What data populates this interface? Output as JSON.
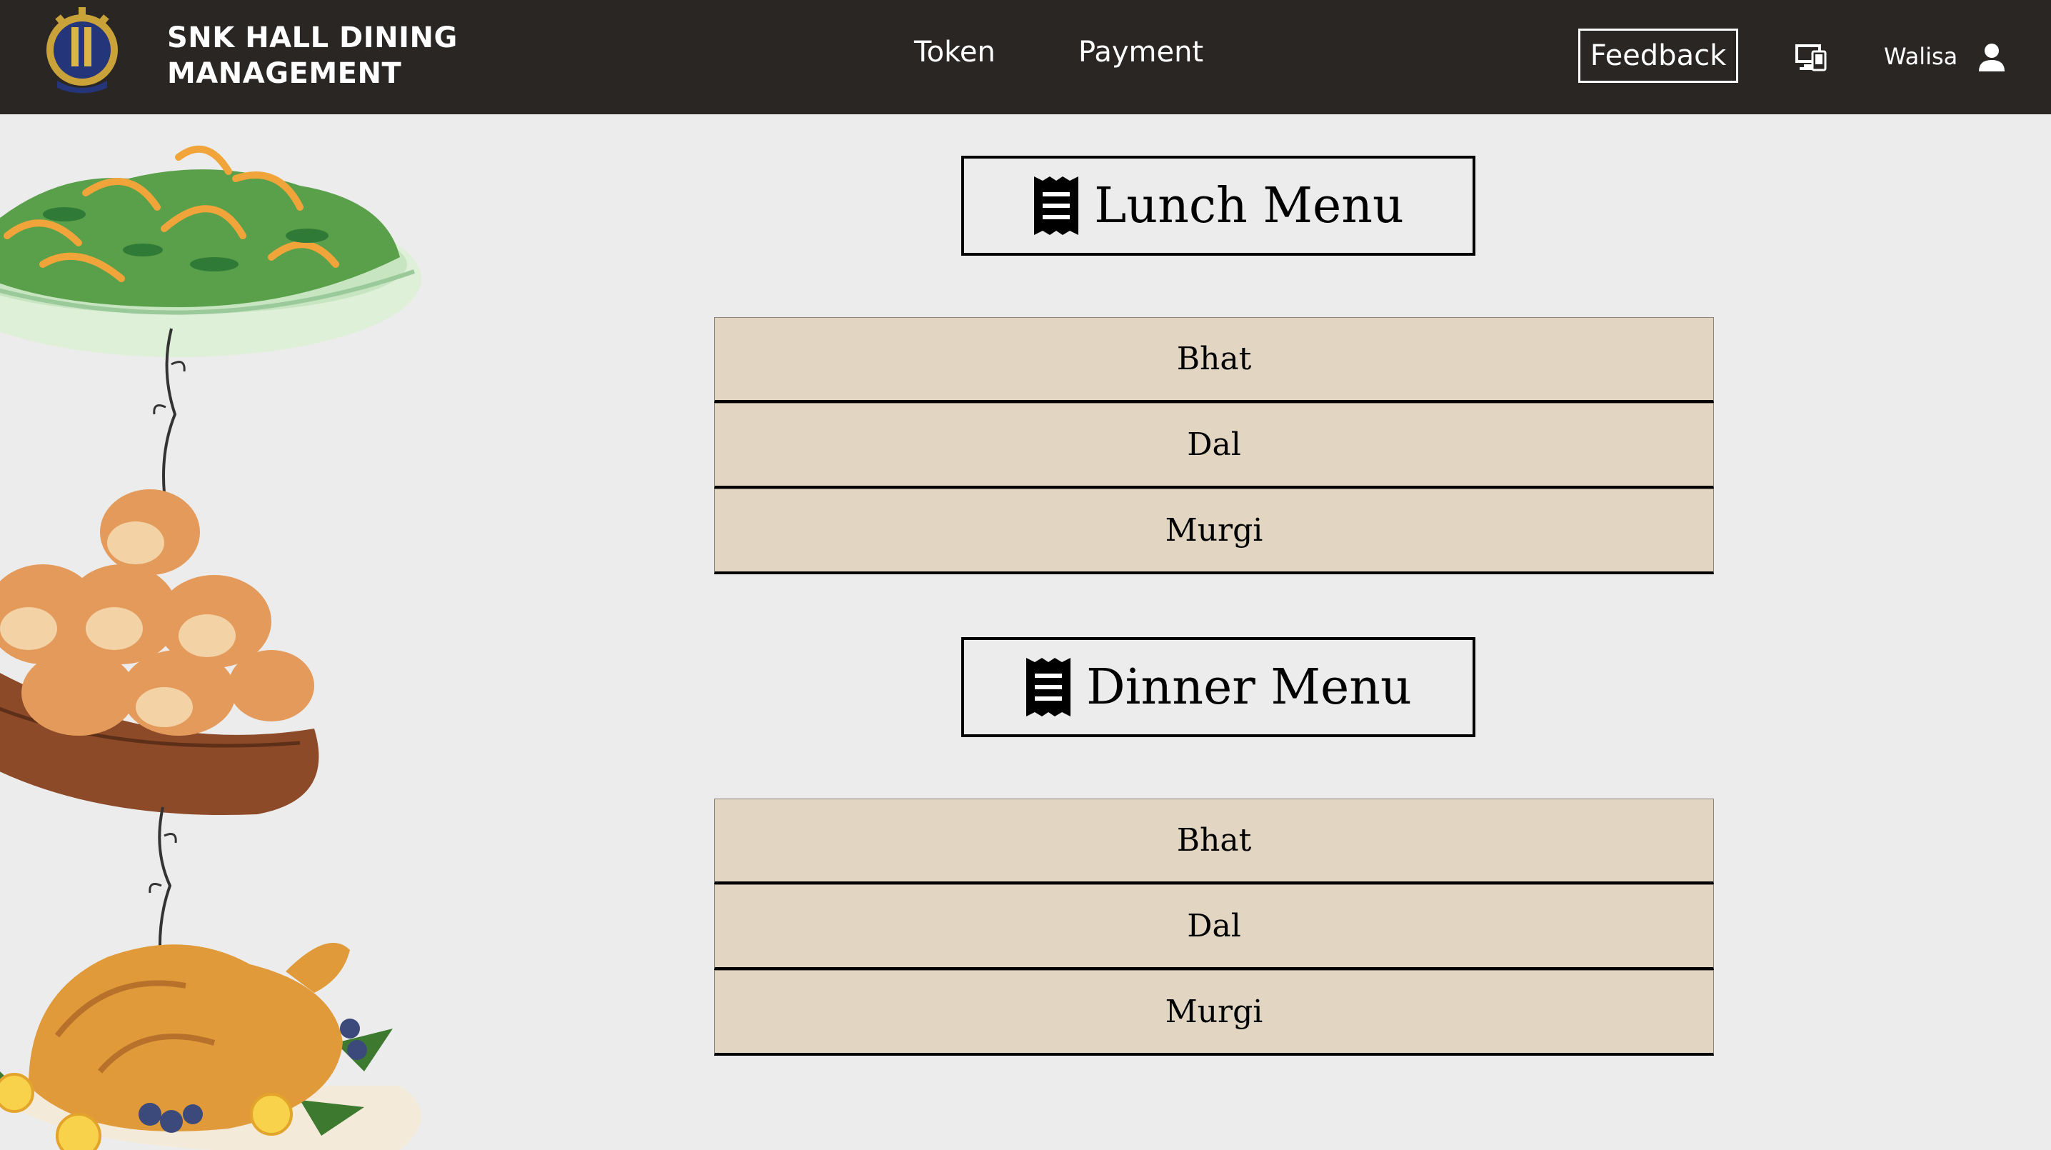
{
  "brand": {
    "line1": "SNK HALL DINING",
    "line2": "MANAGEMENT"
  },
  "nav": {
    "token": "Token",
    "payment": "Payment",
    "feedback": "Feedback"
  },
  "user": {
    "name": "Walisa"
  },
  "icons": {
    "logo": "university-crest-logo",
    "devices": "devices-icon",
    "user": "user-icon",
    "menu": "receipt-icon"
  },
  "colors": {
    "navbar": "#292624",
    "page_background": "#ececec",
    "menu_item_background": "#e2d6c3"
  },
  "lunch": {
    "title": "Lunch Menu",
    "items": [
      "Bhat",
      "Dal",
      "Murgi"
    ]
  },
  "dinner": {
    "title": "Dinner Menu",
    "items": [
      "Bhat",
      "Dal",
      "Murgi"
    ]
  }
}
